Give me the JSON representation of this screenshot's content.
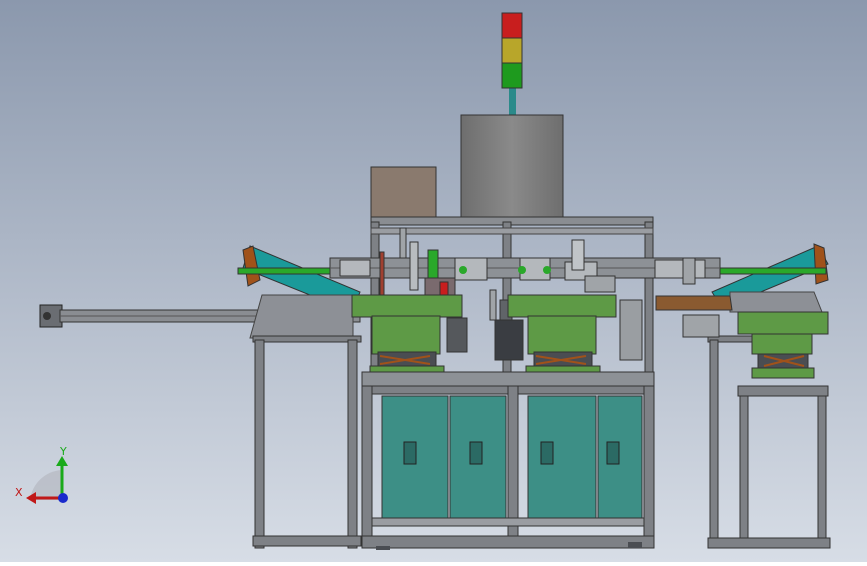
{
  "triad": {
    "y_label": "Y",
    "x_label": "X"
  },
  "colors": {
    "background_top": "#8b98ad",
    "background_bottom": "#d7dde6",
    "frame_gray": "#7e8186",
    "frame_dark": "#4a4d52",
    "cabinet_teal": "#3d8f86",
    "hopper_green": "#5e9a46",
    "chute_teal": "#1a9a9a",
    "gray_box": "#7a7a7a",
    "brown_box": "#8a7a6e",
    "light_red": "#c81e1e",
    "light_yellow": "#b8a62a",
    "light_green": "#1e9a1e",
    "axis_y_green": "#1aaa1a",
    "axis_x_red": "#c01818",
    "origin_blue": "#1a2acc"
  }
}
